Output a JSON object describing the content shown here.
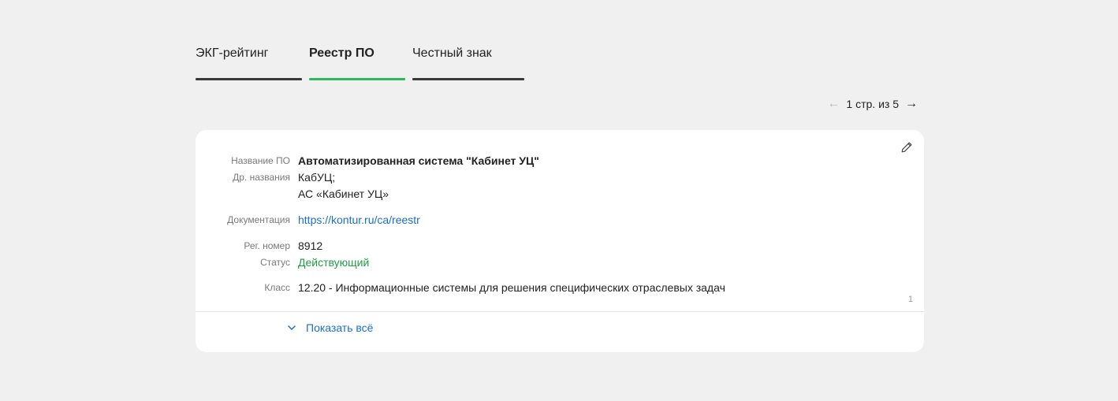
{
  "tabs": [
    {
      "label": "ЭКГ-рейтинг",
      "active": false
    },
    {
      "label": "Реестр ПО",
      "active": true
    },
    {
      "label": "Честный знак",
      "active": false
    }
  ],
  "pager": {
    "text": "1 стр. из 5",
    "prev_icon": "arrow-left-icon",
    "next_icon": "arrow-right-icon"
  },
  "card": {
    "edit_icon": "pencil-icon",
    "fields": {
      "name_label": "Название ПО",
      "name_value": "Автоматизированная система \"Кабинет УЦ\"",
      "alt_label": "Др. названия",
      "alt_value_1": "КабУЦ;",
      "alt_value_2": "АС «Кабинет УЦ»",
      "docs_label": "Документация",
      "docs_value": "https://kontur.ru/ca/reestr",
      "reg_label": "Рег. номер",
      "reg_value": "8912",
      "status_label": "Статус",
      "status_value": "Действующий",
      "class_label": "Класс",
      "class_value": "12.20 - Информационные системы для решения специфических отраслевых задач"
    },
    "counter": "1",
    "show_all_label": "Показать всё"
  },
  "colors": {
    "accent_green": "#2eb85c",
    "link_blue": "#1a6fcc",
    "status_green": "#1f9d45",
    "background": "#f0f0f0"
  }
}
